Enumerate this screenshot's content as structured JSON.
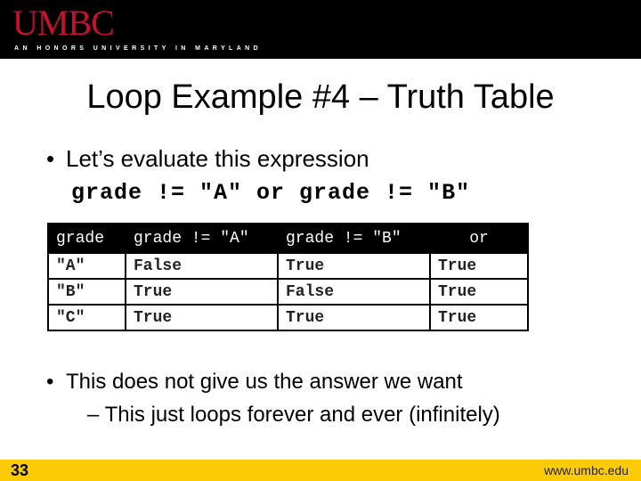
{
  "header": {
    "logo": "UMBC",
    "tagline": "AN HONORS UNIVERSITY IN MARYLAND"
  },
  "slide": {
    "title": "Loop Example #4 – Truth Table",
    "bullet1": "Let’s evaluate this expression",
    "expression": "grade != \"A\" or grade != \"B\"",
    "table": {
      "headers": [
        "grade",
        "grade != \"A\"",
        "grade != \"B\"",
        "or"
      ],
      "rows": [
        [
          "\"A\"",
          "False",
          "True",
          "True"
        ],
        [
          "\"B\"",
          "True",
          "False",
          "True"
        ],
        [
          "\"C\"",
          "True",
          "True",
          "True"
        ]
      ]
    },
    "bullet2": "This does not give us the answer we want",
    "subbullet": "This just loops forever and ever (infinitely)"
  },
  "footer": {
    "page_number": "33",
    "url": "www.umbc.edu"
  }
}
